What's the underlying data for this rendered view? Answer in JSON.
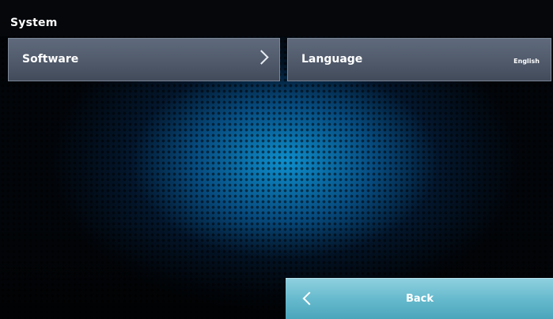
{
  "header": {
    "title": "System"
  },
  "tiles": [
    {
      "label": "Software",
      "value": "",
      "icon": "chevron-right-icon"
    },
    {
      "label": "Language",
      "value": "English"
    }
  ],
  "footer": {
    "back_label": "Back",
    "back_icon": "chevron-left-icon"
  },
  "colors": {
    "background_glow": "#0e96d7",
    "tile": "#556072",
    "back_button": "#67bacd"
  }
}
